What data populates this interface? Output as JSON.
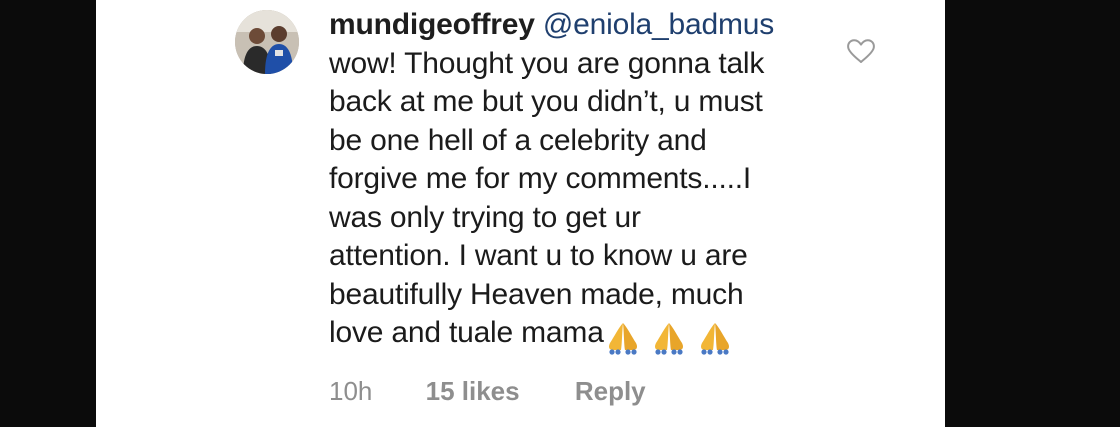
{
  "comment": {
    "username": "mundigeoffrey",
    "mention": "@eniola_badmus",
    "lines": [
      "wow! Thought you are gonna talk",
      "back at me but you didn’t, u must",
      "be one hell of a celebrity and",
      "forgive me for my comments.....I",
      "was only trying to get ur",
      "attention. I want u to know u are",
      "beautifully Heaven made, much",
      "love and tuale mama"
    ],
    "emojis": [
      "folded-hands",
      "folded-hands",
      "folded-hands"
    ]
  },
  "meta": {
    "time": "10h",
    "likes": "15 likes",
    "reply": "Reply"
  },
  "icons": {
    "like": "heart-outline-icon"
  },
  "colors": {
    "background": "#0b0b0b",
    "card": "#ffffff",
    "text": "#1b1b1b",
    "mention": "#1f3f6e",
    "meta": "#8e8e8e",
    "emoji": "#f2b636"
  }
}
